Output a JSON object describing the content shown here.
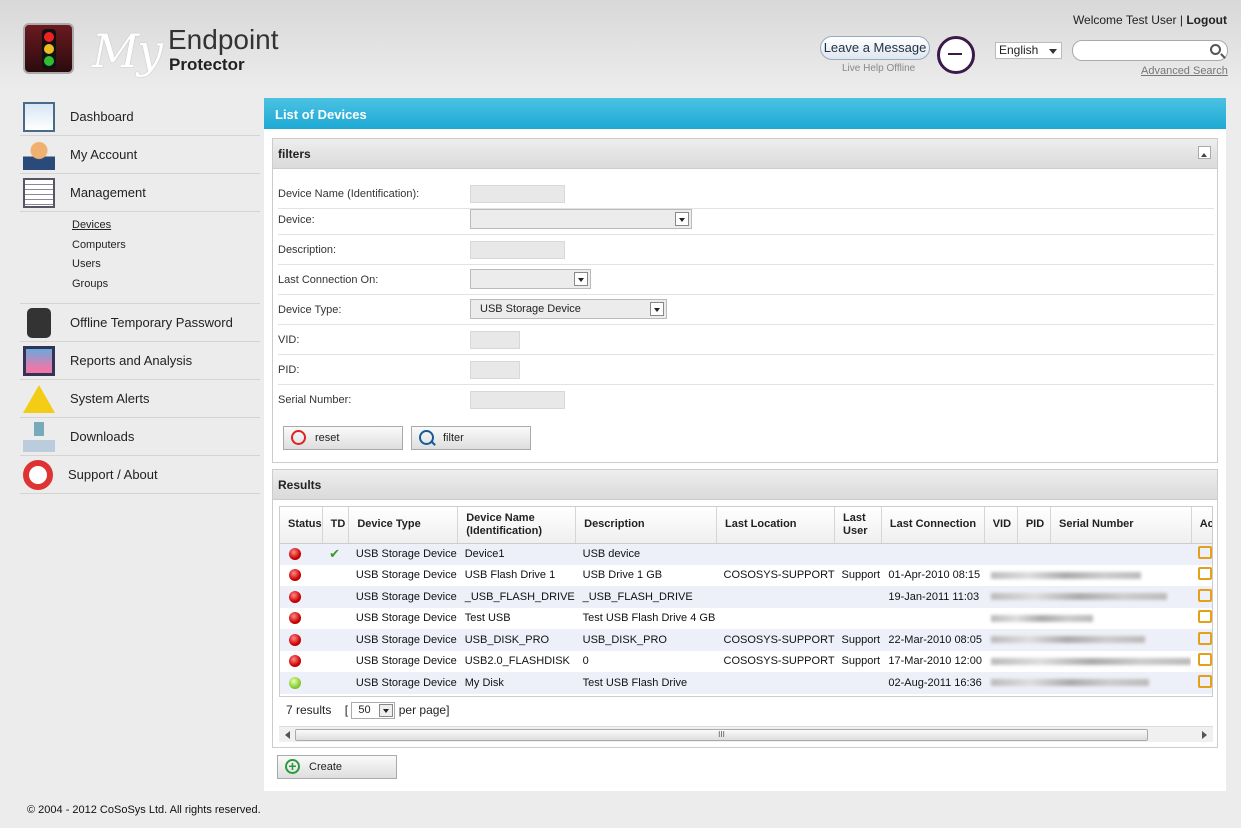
{
  "header": {
    "logo_my": "My",
    "logo_endpoint": "Endpoint",
    "logo_protector": "Protector",
    "leave_message": "Leave a Message",
    "live_help": "Live Help Offline",
    "language": "English",
    "search_placeholder": "",
    "advanced_search": "Advanced Search",
    "welcome": "Welcome Test User",
    "separator": "|",
    "logout": "Logout"
  },
  "sidebar": {
    "items": [
      {
        "label": "Dashboard",
        "icon": "dashboard-icon"
      },
      {
        "label": "My Account",
        "icon": "user-icon"
      },
      {
        "label": "Management",
        "icon": "documents-icon"
      },
      {
        "label": "Offline Temporary Password",
        "icon": "calculator-icon"
      },
      {
        "label": "Reports and Analysis",
        "icon": "monitor-chart-icon"
      },
      {
        "label": "System Alerts",
        "icon": "warning-icon"
      },
      {
        "label": "Downloads",
        "icon": "download-icon"
      },
      {
        "label": "Support / About",
        "icon": "lifebuoy-icon"
      }
    ],
    "management_sub": [
      "Devices",
      "Computers",
      "Users",
      "Groups"
    ]
  },
  "main": {
    "title": "List of Devices",
    "filters": {
      "title": "filters",
      "fields": [
        {
          "label": "Device Name (Identification):",
          "value": ""
        },
        {
          "label": "Device:",
          "value": ""
        },
        {
          "label": "Description:",
          "value": ""
        },
        {
          "label": "Last Connection On:",
          "value": ""
        },
        {
          "label": "Device Type:",
          "value": "USB Storage Device"
        },
        {
          "label": "VID:",
          "value": ""
        },
        {
          "label": "PID:",
          "value": ""
        },
        {
          "label": "Serial Number:",
          "value": ""
        }
      ],
      "reset_label": "reset",
      "filter_label": "filter"
    },
    "results": {
      "title": "Results",
      "columns": [
        "Status",
        "TD",
        "Device Type",
        "Device Name (Identification)",
        "Description",
        "Last Location",
        "Last User",
        "Last Connection",
        "VID",
        "PID",
        "Serial Number",
        "Act"
      ],
      "rows": [
        {
          "status": "red",
          "td": "✔",
          "type": "USB Storage Device",
          "name": "Device1",
          "desc": "USB device",
          "location": "",
          "user": "",
          "conn": "",
          "blur": 0
        },
        {
          "status": "red",
          "td": "",
          "type": "USB Storage Device",
          "name": "USB Flash Drive 1",
          "desc": "USB Drive 1 GB",
          "location": "COSOSYS-SUPPORT",
          "user": "Support",
          "conn": "01-Apr-2010 08:15",
          "blur": 150
        },
        {
          "status": "red",
          "td": "",
          "type": "USB Storage Device",
          "name": "_USB_FLASH_DRIVE",
          "desc": "_USB_FLASH_DRIVE",
          "location": "",
          "user": "",
          "conn": "19-Jan-2011 11:03",
          "blur": 176
        },
        {
          "status": "red",
          "td": "",
          "type": "USB Storage Device",
          "name": "Test USB",
          "desc": "Test USB Flash Drive 4 GB",
          "location": "",
          "user": "",
          "conn": "",
          "blur": 102
        },
        {
          "status": "red",
          "td": "",
          "type": "USB Storage Device",
          "name": "USB_DISK_PRO",
          "desc": "USB_DISK_PRO",
          "location": "COSOSYS-SUPPORT",
          "user": "Support",
          "conn": "22-Mar-2010 08:05",
          "blur": 154
        },
        {
          "status": "red",
          "td": "",
          "type": "USB Storage Device",
          "name": "USB2.0_FLASHDISK",
          "desc": "0",
          "location": "COSOSYS-SUPPORT",
          "user": "Support",
          "conn": "17-Mar-2010 12:00",
          "blur": 200
        },
        {
          "status": "green",
          "td": "",
          "type": "USB Storage Device",
          "name": "My Disk",
          "desc": "Test USB Flash Drive",
          "location": "",
          "user": "",
          "conn": "02-Aug-2011 16:36",
          "blur": 158
        }
      ],
      "count_text": "7 results",
      "bracket_open": "[",
      "per_page": "50",
      "per_page_text": "per page]",
      "scroll_grip": "III"
    },
    "create_label": "Create"
  },
  "footer": "© 2004 - 2012 CoSoSys Ltd. All rights reserved."
}
